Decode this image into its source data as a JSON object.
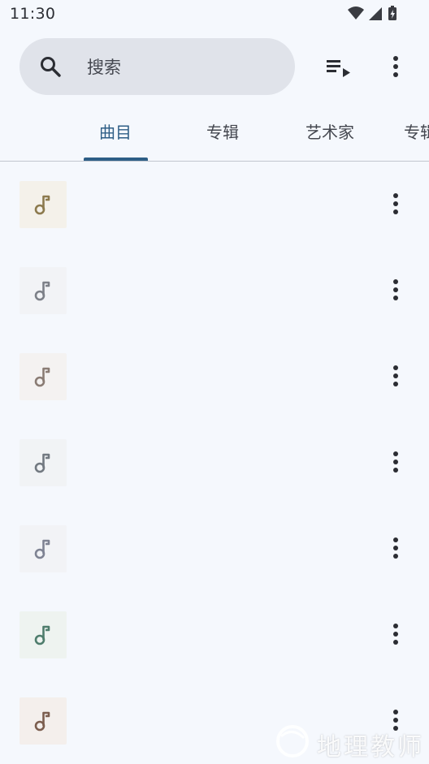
{
  "status_bar": {
    "time": "11:30",
    "icons": [
      "wifi-icon",
      "cell-signal-icon",
      "battery-charging-icon"
    ]
  },
  "search": {
    "placeholder": "搜索"
  },
  "toolbar": {
    "queue_icon": "playlist-play-icon",
    "more_icon": "more-vert-icon"
  },
  "tabs": [
    {
      "label": "曲目",
      "active": true
    },
    {
      "label": "专辑",
      "active": false
    },
    {
      "label": "艺术家",
      "active": false
    },
    {
      "label": "专辑",
      "active": false
    }
  ],
  "colors": {
    "accent": "#2e5e86",
    "background": "#f5f8fd",
    "search_fill": "#e0e3ea"
  },
  "tracks": [
    {
      "title": "",
      "thumb_bg": "#f4f1ea",
      "note_color": "#8c7a4e"
    },
    {
      "title": "",
      "thumb_bg": "#f2f3f6",
      "note_color": "#7d8088"
    },
    {
      "title": "",
      "thumb_bg": "#f4f2f1",
      "note_color": "#8a7c74"
    },
    {
      "title": "",
      "thumb_bg": "#f1f3f5",
      "note_color": "#727981"
    },
    {
      "title": "",
      "thumb_bg": "#f2f3f6",
      "note_color": "#7f8393"
    },
    {
      "title": "",
      "thumb_bg": "#eef3f0",
      "note_color": "#4f7d6d"
    },
    {
      "title": "",
      "thumb_bg": "#f4efec",
      "note_color": "#7c5e4f"
    }
  ],
  "watermark": {
    "text": "地理教师"
  }
}
